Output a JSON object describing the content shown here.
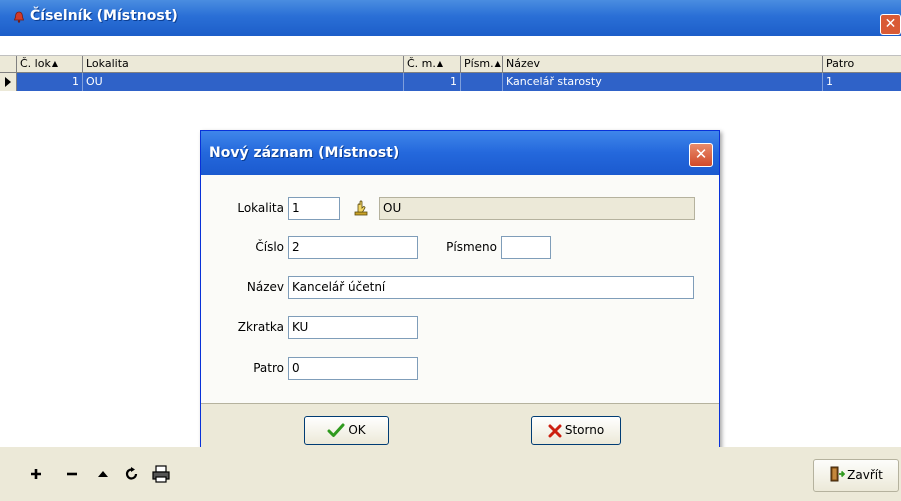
{
  "window": {
    "title": "Číselník (Místnost)",
    "close_symbol": "✕"
  },
  "grid": {
    "columns": [
      {
        "label": "Č. lok",
        "sort": "asc"
      },
      {
        "label": "Lokalita",
        "sort": null
      },
      {
        "label": "Č. m.",
        "sort": "asc"
      },
      {
        "label": "Písm.",
        "sort": "asc"
      },
      {
        "label": "Název",
        "sort": null
      },
      {
        "label": "Patro",
        "sort": null
      }
    ],
    "rows": [
      {
        "c_lok": "1",
        "lokalita": "OU",
        "c_m": "1",
        "pism": "",
        "nazev": "Kancelář starosty",
        "patro": "1",
        "selected": true
      }
    ]
  },
  "dialog": {
    "title": "Nový záznam (Místnost)",
    "close_symbol": "✕",
    "fields": {
      "lokalita_label": "Lokalita",
      "lokalita_value": "1",
      "lokalita_name": "OU",
      "cislo_label": "Číslo",
      "cislo_value": "2",
      "pismeno_label": "Písmeno",
      "pismeno_value": "",
      "nazev_label": "Název",
      "nazev_value": "Kancelář účetní",
      "zkratka_label": "Zkratka",
      "zkratka_value": "KU",
      "patro_label": "Patro",
      "patro_value": "0"
    },
    "ok_label": "OK",
    "cancel_label": "Storno"
  },
  "toolbar": {
    "icons": [
      "add-icon",
      "delete-icon",
      "up-icon",
      "refresh-icon",
      "print-icon"
    ],
    "close_label": "Zavřít"
  },
  "colors": {
    "title_bar": "#2a6fd6",
    "selected_row": "#2f62c8",
    "close_button": "#d95a35"
  }
}
